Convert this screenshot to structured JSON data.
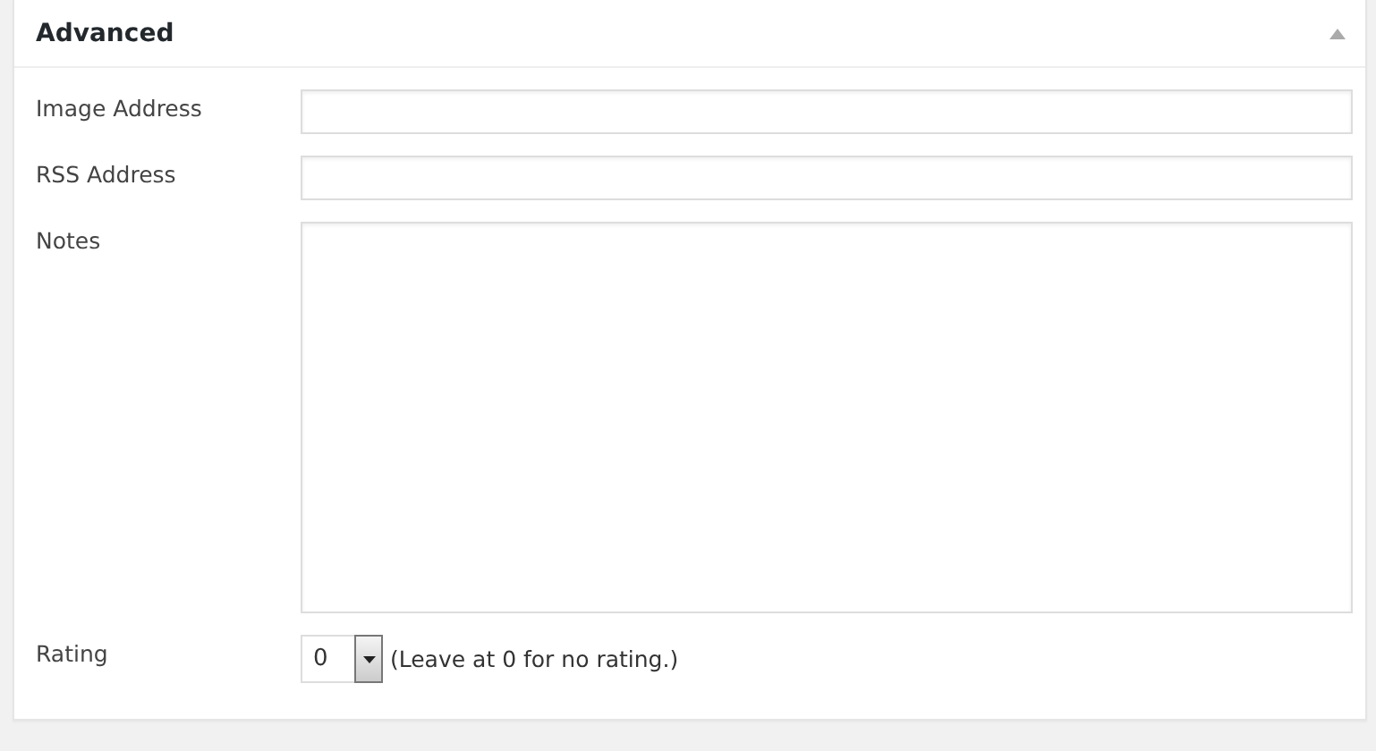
{
  "panel": {
    "title": "Advanced",
    "expanded": true
  },
  "fields": [
    {
      "kind": "text",
      "label": "Image Address"
    },
    {
      "kind": "text",
      "label": "RSS Address"
    },
    {
      "kind": "textarea",
      "label": "Notes"
    },
    {
      "kind": "select",
      "label": "Rating",
      "value": "0",
      "hint": "(Leave at 0 for no rating.)"
    }
  ]
}
